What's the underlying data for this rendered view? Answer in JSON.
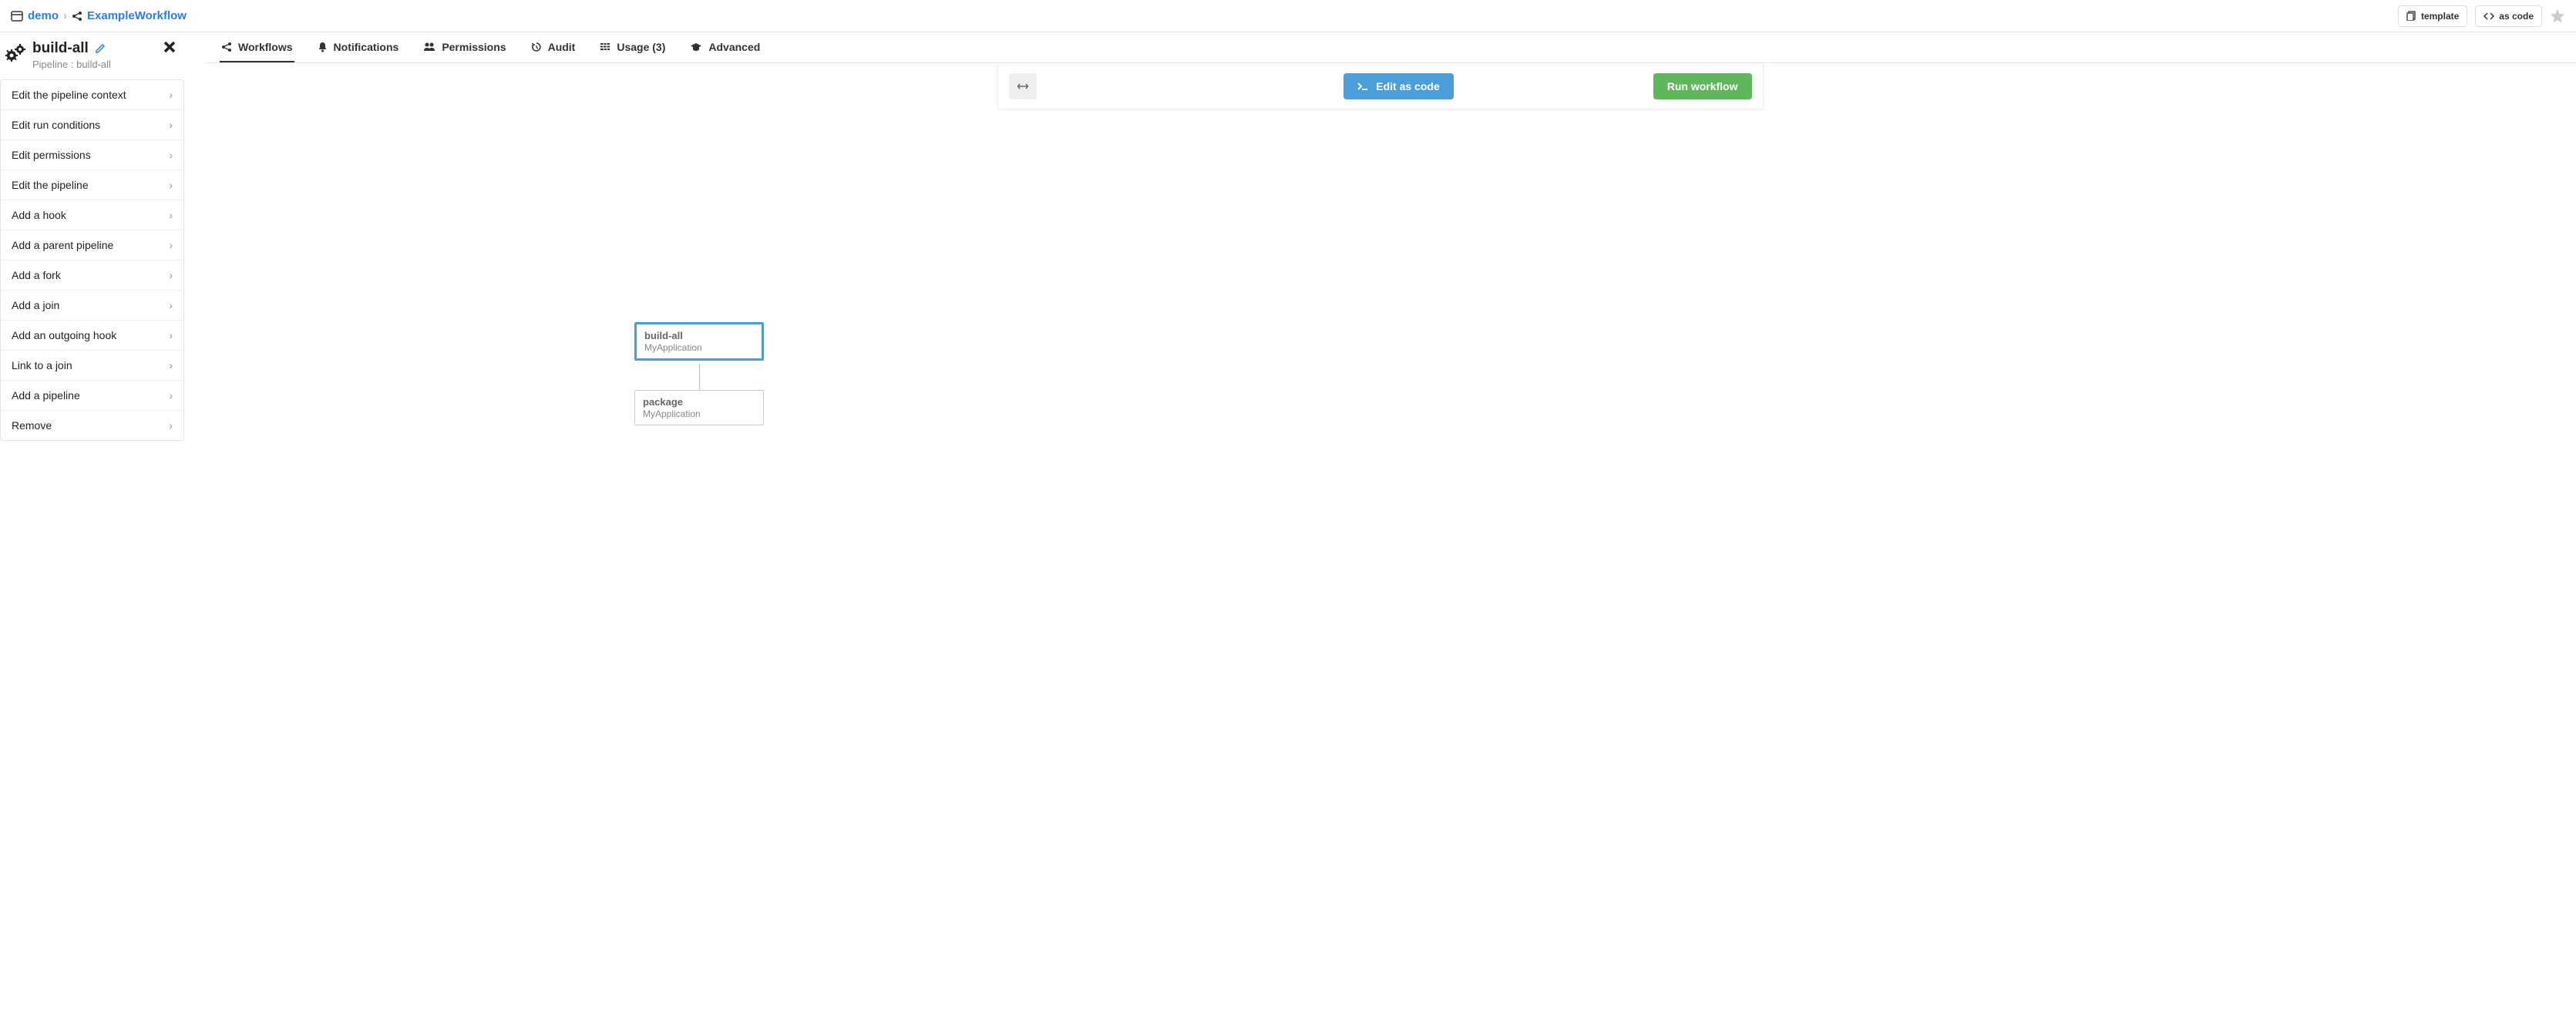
{
  "breadcrumb": {
    "project": "demo",
    "workflow": "ExampleWorkflow"
  },
  "topbar_buttons": {
    "template": "template",
    "as_code": "as code"
  },
  "sidebar": {
    "title": "build-all",
    "subtitle": "Pipeline : build-all",
    "items": [
      "Edit the pipeline context",
      "Edit run conditions",
      "Edit permissions",
      "Edit the pipeline",
      "Add a hook",
      "Add a parent pipeline",
      "Add a fork",
      "Add a join",
      "Add an outgoing hook",
      "Link to a join",
      "Add a pipeline",
      "Remove"
    ]
  },
  "tabs": {
    "workflows": "Workflows",
    "notifications": "Notifications",
    "permissions": "Permissions",
    "audit": "Audit",
    "usage": "Usage (3)",
    "advanced": "Advanced"
  },
  "actions": {
    "edit_as_code": "Edit as code",
    "run_workflow": "Run workflow"
  },
  "nodes": {
    "n1": {
      "title": "build-all",
      "sub": "MyApplication"
    },
    "n2": {
      "title": "package",
      "sub": "MyApplication"
    }
  }
}
